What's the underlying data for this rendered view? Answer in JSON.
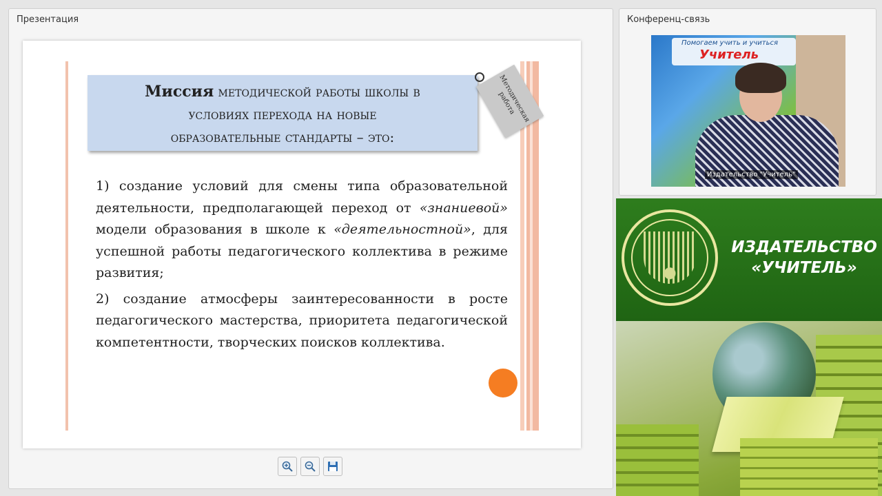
{
  "presentation_panel": {
    "title": "Презентация",
    "slide": {
      "heading_lead": "Миссия",
      "heading_rest_line1": " методической работы школы в",
      "heading_line2": "условиях перехода на новые",
      "heading_line3": "образовательные стандарты – это:",
      "tag_text": "Методическая работа",
      "paragraph1_a": "1) создание условий для смены типа образовательной деятельности, предполагающей переход от ",
      "paragraph1_em1": "«знаниевой»",
      "paragraph1_b": " модели образования в школе к ",
      "paragraph1_em2": "«деятельностной»",
      "paragraph1_c": ", для успешной работы педагогического коллектива в режиме развития;",
      "paragraph2": "2) создание атмосферы заинтересованности в росте педагогического мастерства, приоритета педагогической компетентности, творческих поисков коллектива.",
      "accent_color": "#f57d22"
    },
    "toolbar": {
      "zoom_in_icon": "zoom-in-icon",
      "zoom_out_icon": "zoom-out-icon",
      "save_icon": "save-icon"
    }
  },
  "conference_panel": {
    "title": "Конференц-связь",
    "video": {
      "banner_text": "Помогаем учить и учиться",
      "logo_text": "Учитель",
      "caption": "Издательство \"Учитель\""
    }
  },
  "publisher_banner": {
    "line1": "ИЗДАТЕЛЬСТВО",
    "line2": "«УЧИТЕЛЬ»",
    "background_color": "#2e7d1d",
    "logo_color": "#e9e7a0"
  }
}
